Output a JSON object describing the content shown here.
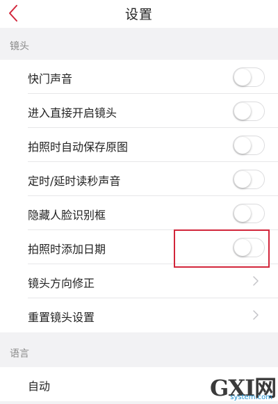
{
  "header": {
    "title": "设置",
    "back_icon": "chevron-left-icon"
  },
  "colors": {
    "accent": "#d2253a",
    "background": "#f2f2f4"
  },
  "sections": {
    "camera": {
      "title": "镜头",
      "items": [
        {
          "label": "快门声音",
          "control": "toggle",
          "on": false
        },
        {
          "label": "进入直接开启镜头",
          "control": "toggle",
          "on": false
        },
        {
          "label": "拍照时自动保存原图",
          "control": "toggle",
          "on": false
        },
        {
          "label": "定时/延时读秒声音",
          "control": "toggle",
          "on": false
        },
        {
          "label": "隐藏人脸识别框",
          "control": "toggle",
          "on": false
        },
        {
          "label": "拍照时添加日期",
          "control": "toggle",
          "on": false,
          "highlighted": true
        },
        {
          "label": "镜头方向修正",
          "control": "chevron"
        },
        {
          "label": "重置镜头设置",
          "control": "chevron"
        }
      ]
    },
    "language": {
      "title": "语言",
      "items": [
        {
          "label": "自动"
        }
      ]
    }
  },
  "watermark": {
    "logo": "GXI网",
    "site": "system.com"
  }
}
